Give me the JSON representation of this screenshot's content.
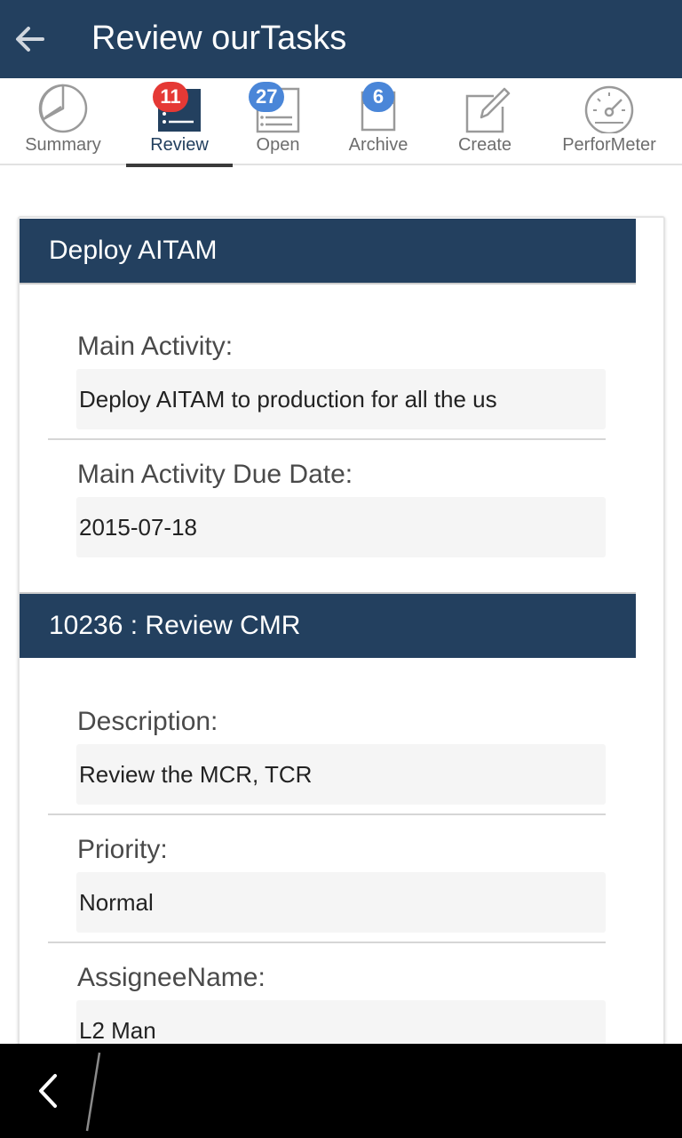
{
  "appbar": {
    "title": "Review ourTasks",
    "back_icon": "arrow-left-icon"
  },
  "tabs": [
    {
      "label": "Summary",
      "icon": "pie-chart-icon",
      "badge": null,
      "active": false
    },
    {
      "label": "Review",
      "icon": "review-list-icon",
      "badge": "11",
      "badge_color": "#e53935",
      "active": true
    },
    {
      "label": "Open",
      "icon": "open-list-icon",
      "badge": "27",
      "badge_color": "#4a86d8",
      "active": false
    },
    {
      "label": "Archive",
      "icon": "archive-box-icon",
      "badge": "6",
      "badge_color": "#4a86d8",
      "active": false
    },
    {
      "label": "Create",
      "icon": "edit-pencil-icon",
      "badge": null,
      "active": false
    },
    {
      "label": "PerforMeter",
      "icon": "speedometer-icon",
      "badge": null,
      "active": false
    }
  ],
  "sections": [
    {
      "header": "Deploy AITAM",
      "fields": [
        {
          "label": "Main Activity:",
          "value": "Deploy AITAM to production for all the us"
        },
        {
          "label": "Main Activity Due Date:",
          "value": "2015-07-18"
        }
      ]
    },
    {
      "header": "10236 : Review CMR",
      "fields": [
        {
          "label": "Description:",
          "value": "Review the MCR, TCR"
        },
        {
          "label": "Priority:",
          "value": "Normal"
        },
        {
          "label": "AssigneeName:",
          "value": "L2 Man"
        }
      ]
    }
  ],
  "colors": {
    "primary": "#23405f",
    "badge_red": "#e53935",
    "badge_blue": "#4a86d8"
  },
  "bottomnav": {
    "back_icon": "chevron-left-icon"
  }
}
